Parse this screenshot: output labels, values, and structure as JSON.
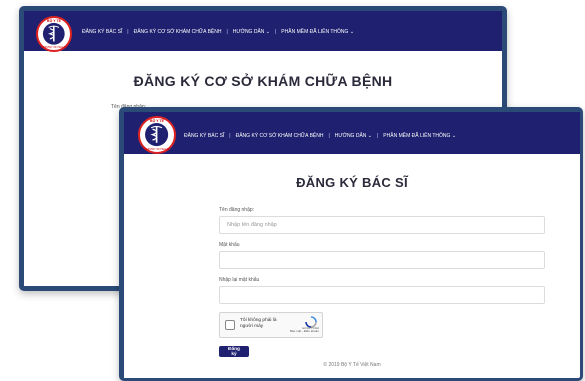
{
  "nav": {
    "back_items": [
      "ĐĂNG KÝ BÁC SĨ",
      "|",
      "ĐĂNG KÝ CƠ SỞ KHÁM CHỮA BỆNH",
      "|",
      "HƯỚNG DẪN ⌄",
      "|",
      "PHẦN MỀM ĐÃ LIÊN THÔNG ⌄"
    ],
    "front_items": [
      "ĐĂNG KÝ BÁC SĨ",
      "|",
      "ĐĂNG KÝ CƠ SỞ KHÁM CHỮA BỆNH",
      "|",
      "HƯỚNG DẪN ⌄",
      "|",
      "PHẦN MỀM ĐÃ LIÊN THÔNG ⌄"
    ]
  },
  "logo": {
    "top_text": "BỘ Y TẾ",
    "bottom_text": "MINISTRY OF HEALTH",
    "icon": "caduceus-icon"
  },
  "back_page": {
    "title": "ĐĂNG KÝ CƠ SỞ KHÁM CHỮA BỆNH",
    "first_label": "Tên đăng nhập:"
  },
  "form": {
    "title": "ĐĂNG KÝ BÁC SĨ",
    "username_label": "Tên đăng nhập:",
    "username_placeholder": "Nhập tên đăng nhập",
    "password_label": "Mật khẩu",
    "password_placeholder": "",
    "confirm_label": "Nhập lại mật khẩu",
    "confirm_placeholder": "",
    "captcha_text": "Tôi không phải là người máy",
    "captcha_brand": "reCAPTCHA",
    "captcha_links": "Bảo mật - Điều khoản",
    "submit_label": "Đăng ký"
  },
  "footer": {
    "text": "© 2019 Bộ Y Tế Việt Nam"
  },
  "colors": {
    "navbar": "#1f2170",
    "frame_border": "#2b4a78",
    "button": "#1f2170"
  }
}
